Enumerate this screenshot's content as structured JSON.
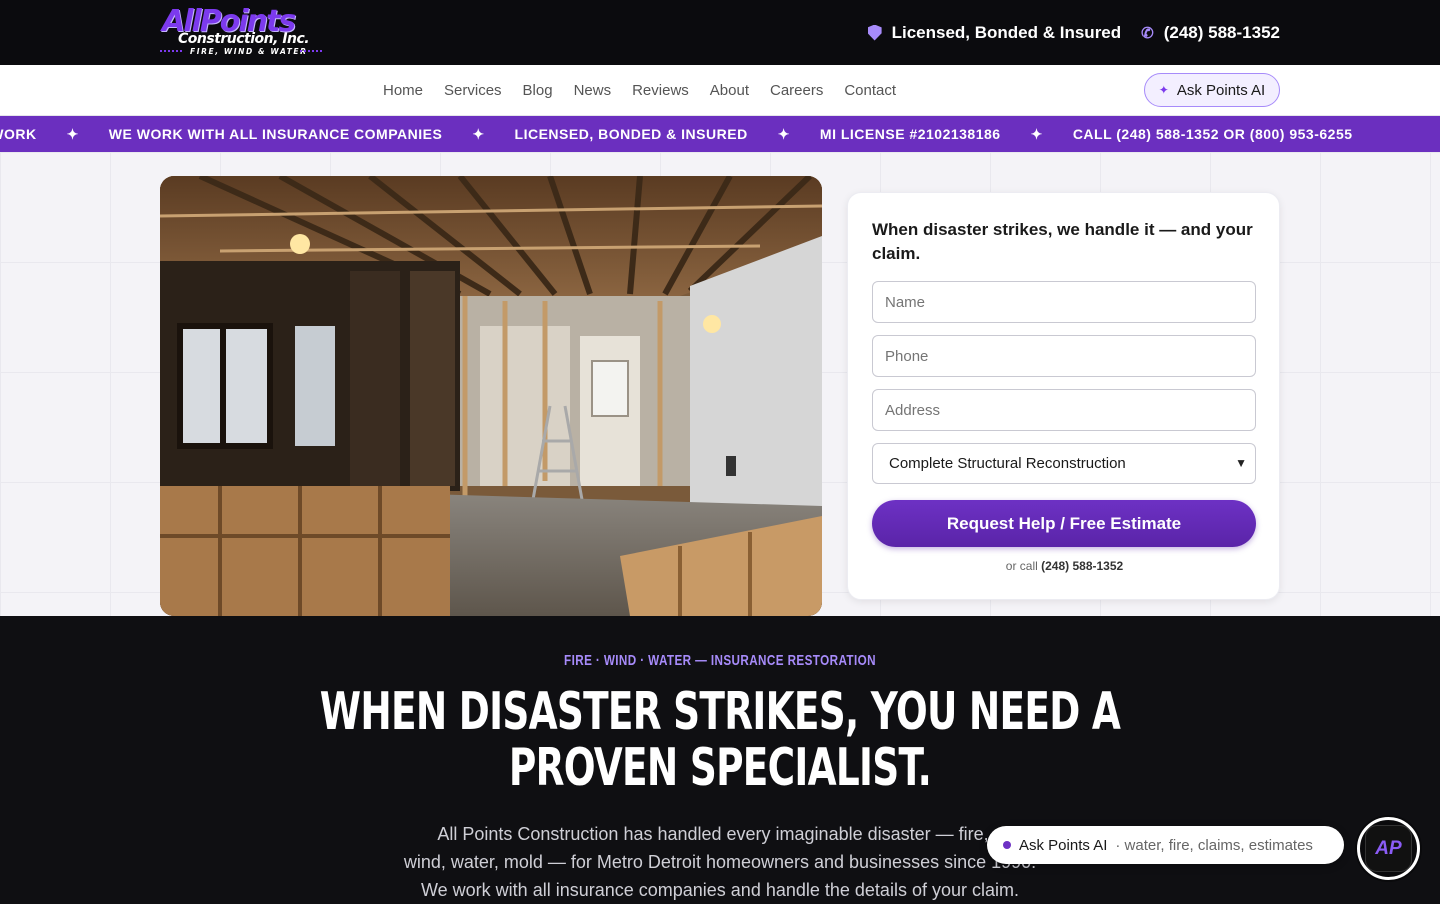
{
  "brand": {
    "logo_main": "AllPoints",
    "logo_sub": "Construction, Inc.",
    "logo_tagline": "FIRE, WIND & WATER"
  },
  "topbar": {
    "licensed": "Licensed, Bonded & Insured",
    "phone": "(248) 588-1352",
    "shield_icon": "shield-check-icon",
    "phone_icon": "phone-icon"
  },
  "nav": {
    "links": [
      "Home",
      "Services",
      "Blog",
      "News",
      "Reviews",
      "About",
      "Careers",
      "Contact"
    ],
    "ask_button": "Ask Points AI"
  },
  "ticker": {
    "items": [
      "E WORK",
      "WE WORK WITH ALL INSURANCE COMPANIES",
      "LICENSED, BONDED & INSURED",
      "MI LICENSE #2102138186",
      "CALL (248) 588-1352 OR (800) 953-6255"
    ],
    "separator": "✦"
  },
  "form": {
    "title": "When disaster strikes, we handle it — and your claim.",
    "name_placeholder": "Name",
    "phone_placeholder": "Phone",
    "address_placeholder": "Address",
    "service_selected": "Complete Structural Reconstruction",
    "submit_label": "Request Help / Free Estimate",
    "or_call_prefix": "or call",
    "or_call_phone": "(248) 588-1352"
  },
  "section": {
    "eyebrow": "FIRE · WIND · WATER — INSURANCE RESTORATION",
    "headline_line1": "WHEN DISASTER STRIKES, YOU NEED A",
    "headline_line2": "PROVEN SPECIALIST.",
    "para_line1": "All Points Construction has handled every imaginable disaster — fire, s",
    "para_line2": "wind, water, mold — for Metro Detroit homeowners and businesses since 1990.",
    "para_line3": "We work with all insurance companies and handle the details of your claim."
  },
  "chat": {
    "pill_label": "Ask Points AI",
    "pill_sub": "· water, fire, claims, estimates",
    "badge": "AP"
  },
  "colors": {
    "accent": "#6b2fbf",
    "accent_light": "#a78bfa",
    "dark_bg": "#0f0f12"
  }
}
